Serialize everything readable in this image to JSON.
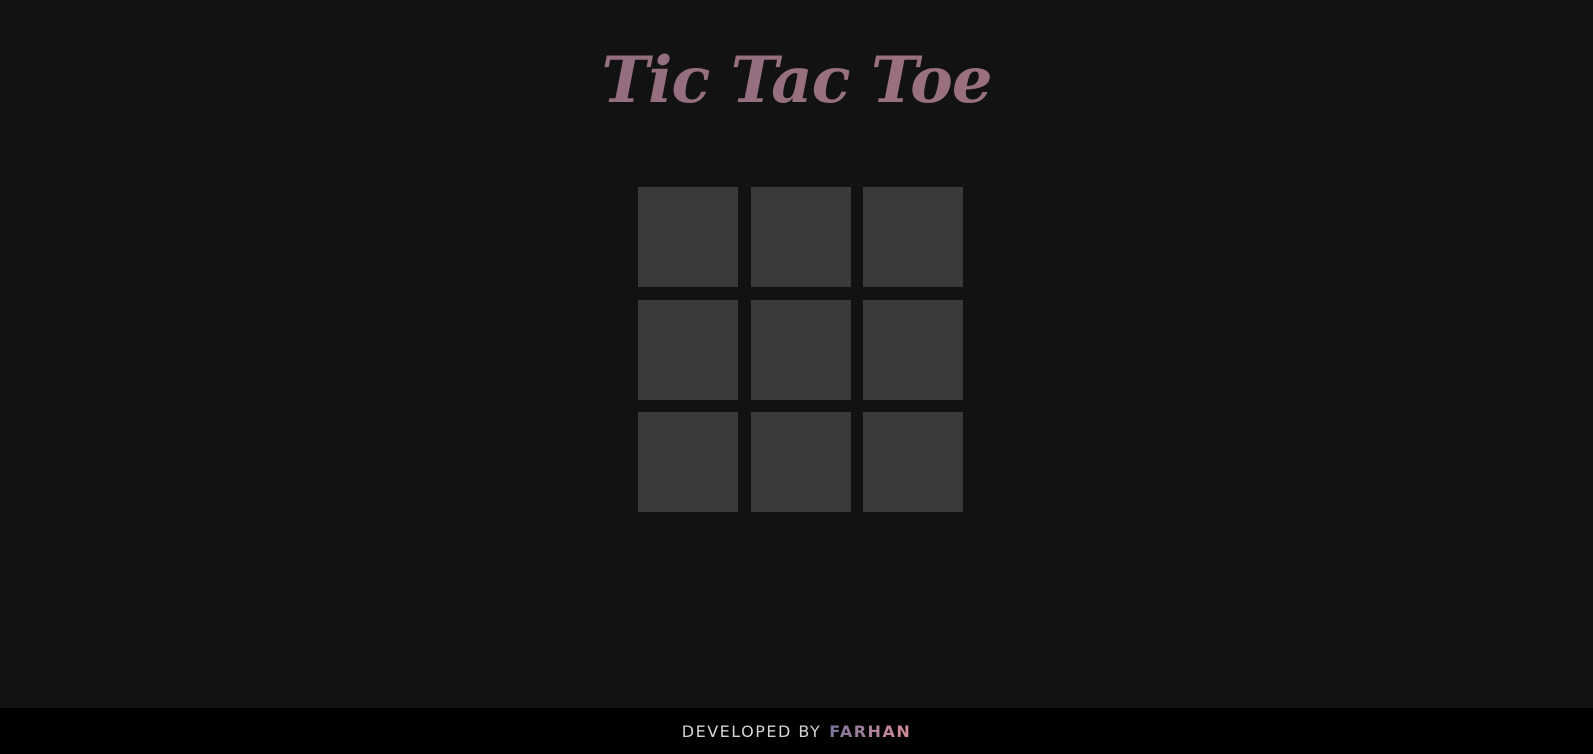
{
  "game": {
    "title": "Tic Tac Toe",
    "board": {
      "cells": [
        "",
        "",
        "",
        "",
        "",
        "",
        "",
        "",
        ""
      ]
    }
  },
  "footer": {
    "label": "DEVELOPED BY",
    "author": "FARHAN"
  },
  "colors": {
    "background": "#121212",
    "cell": "#3a3a3a",
    "footer_bg": "#000000",
    "title_gradient_start": "#8a6b7e",
    "title_gradient_end": "#a47481",
    "author_gradient_start": "#7a76a0",
    "author_gradient_end": "#d88a98"
  }
}
